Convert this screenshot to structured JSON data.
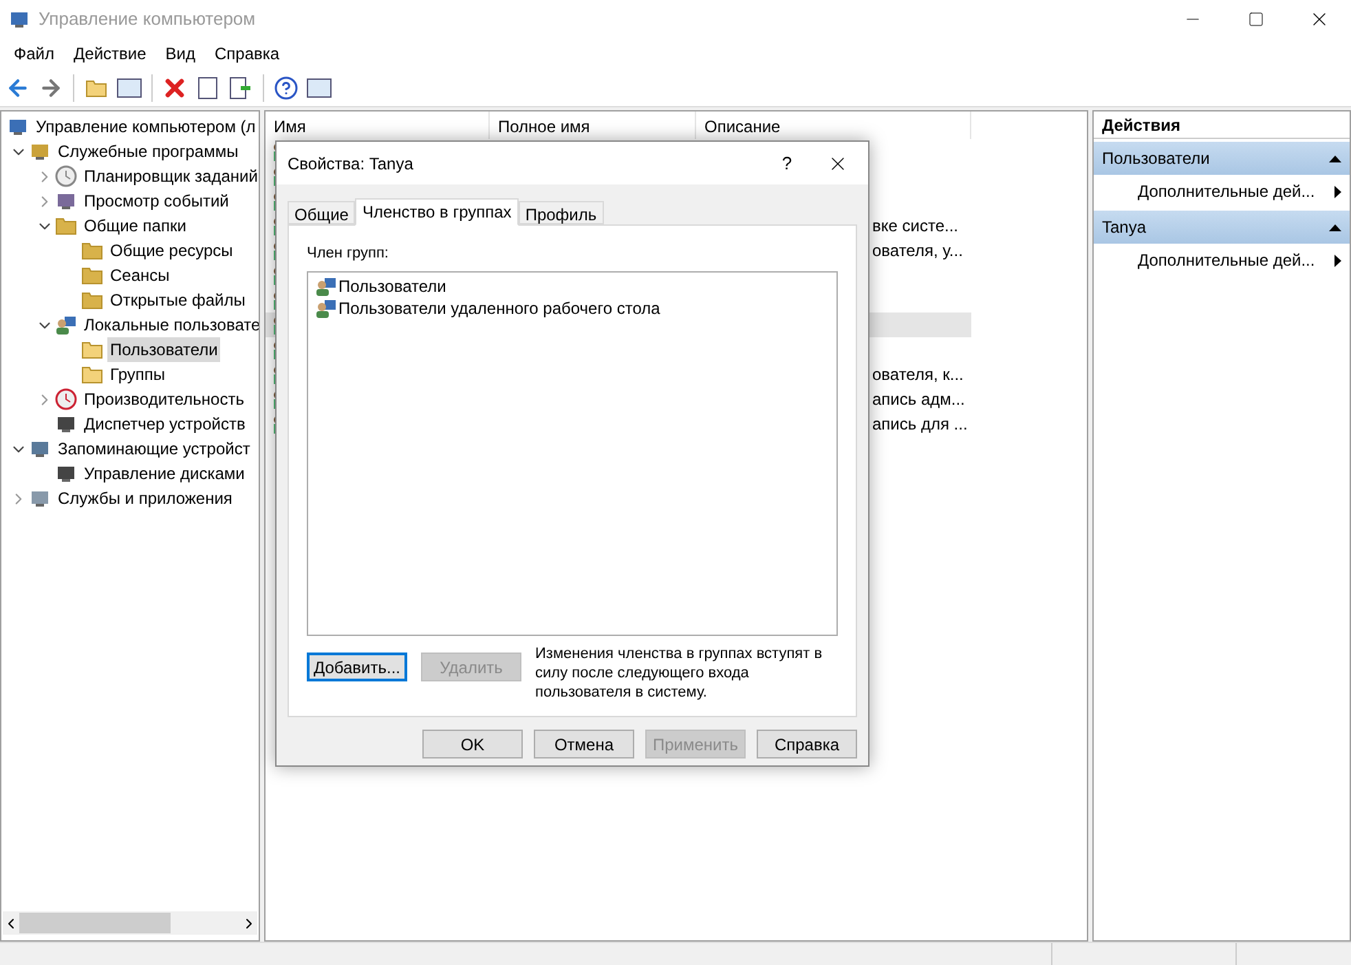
{
  "window": {
    "title": "Управление компьютером"
  },
  "menu": [
    "Файл",
    "Действие",
    "Вид",
    "Справка"
  ],
  "tree": [
    {
      "label": "Управление компьютером (л",
      "selected": false,
      "children": [
        {
          "label": "Служебные программы",
          "selected": false,
          "expanded": true,
          "children": [
            {
              "label": "Планировщик заданий",
              "selected": false,
              "expanded": false
            },
            {
              "label": "Просмотр событий",
              "selected": false,
              "expanded": false
            },
            {
              "label": "Общие папки",
              "selected": false,
              "expanded": true,
              "children": [
                {
                  "label": "Общие ресурсы",
                  "selected": false
                },
                {
                  "label": "Сеансы",
                  "selected": false
                },
                {
                  "label": "Открытые файлы",
                  "selected": false
                }
              ]
            },
            {
              "label": "Локальные пользовате",
              "selected": false,
              "expanded": true,
              "children": [
                {
                  "label": "Пользователи",
                  "selected": true
                },
                {
                  "label": "Группы",
                  "selected": false
                }
              ]
            },
            {
              "label": "Производительность",
              "selected": false,
              "expanded": false
            },
            {
              "label": "Диспетчер устройств",
              "selected": false
            }
          ]
        },
        {
          "label": "Запоминающие устройст",
          "selected": false,
          "expanded": true,
          "children": [
            {
              "label": "Управление дисками",
              "selected": false
            }
          ]
        },
        {
          "label": "Службы и приложения",
          "selected": false,
          "expanded": false
        }
      ]
    }
  ],
  "table": {
    "columns": [
      "Имя",
      "Полное имя",
      "Описание"
    ],
    "rows": [
      {
        "selected": false
      },
      {
        "selected": false
      },
      {
        "selected": false
      },
      {
        "description": "вке систе...",
        "selected": false
      },
      {
        "description": "ователя, у...",
        "selected": false
      },
      {
        "selected": false
      },
      {
        "selected": false
      },
      {
        "selected": true
      },
      {
        "selected": false
      },
      {
        "description": "ователя, к...",
        "selected": false
      },
      {
        "description": "апись адм...",
        "selected": false
      },
      {
        "description": "апись для ...",
        "selected": false
      }
    ]
  },
  "actions": {
    "title": "Действия",
    "sections": [
      {
        "title": "Пользователи",
        "items": [
          "Дополнительные дей..."
        ]
      },
      {
        "title": "Tanya",
        "items": [
          "Дополнительные дей..."
        ]
      }
    ]
  },
  "dialog": {
    "title": "Свойства: Tanya",
    "help": "?",
    "tabs": [
      {
        "label": "Общие",
        "selected": false
      },
      {
        "label": "Членство в группах",
        "selected": true
      },
      {
        "label": "Профиль",
        "selected": false
      }
    ],
    "list_label": "Член групп:",
    "groups": [
      "Пользователи",
      "Пользователи удаленного рабочего стола"
    ],
    "add_button": {
      "label": "Добавить...",
      "disabled": false
    },
    "remove_button": {
      "label": "Удалить",
      "disabled": true
    },
    "note": "Изменения членства в группах вступят в силу после следующего входа пользователя в систему.",
    "buttons": [
      {
        "label": "OK",
        "disabled": false
      },
      {
        "label": "Отмена",
        "disabled": false
      },
      {
        "label": "Применить",
        "disabled": true
      },
      {
        "label": "Справка",
        "disabled": false
      }
    ]
  }
}
